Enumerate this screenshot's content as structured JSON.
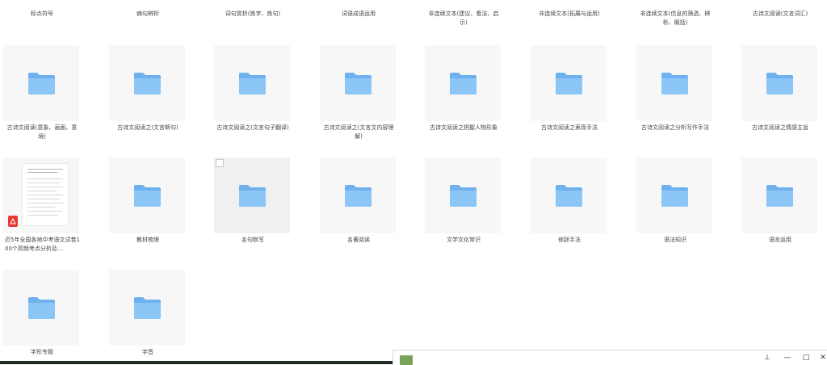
{
  "top_row_labels": [
    "标点符号",
    "病句辨析",
    "词句赏析(炼字、炼句)",
    "词语成语运用",
    "非连续文本(建议、看法、启示)",
    "非连续文本(拓展与运用)",
    "非连续文本(信息的筛选、辨析、概括)",
    "古诗文阅读(文言词汇)"
  ],
  "row2": [
    "古诗文阅读(意象、画面、意境)",
    "古诗文阅读之(文言断句)",
    "古诗文阅读之(文言句子翻译)",
    "古诗文阅读之(文言文内容理解)",
    "古诗文阅读之把握人物形象",
    "古诗文阅读之表现手法",
    "古诗文阅读之分析写作手法",
    "古诗文阅读之情感主旨"
  ],
  "row3": [
    "近5年全国各地中考语文试卷100个高频考点分析及...",
    "教材梳理",
    "名句默写",
    "名著阅读",
    "文学文化常识",
    "修辞手法",
    "语法知识",
    "语言运用"
  ],
  "row4": [
    "字形专题",
    "字音"
  ],
  "icons": {
    "folder": "folder-icon",
    "pdf": "pdf-icon"
  },
  "colors": {
    "folder_back": "#6fb1ef",
    "folder_front": "#8cc6f7",
    "pdf_red": "#e53935"
  },
  "taskbar": {
    "pin": "⊥",
    "minimize": "—",
    "maximize": "□",
    "close": "✕"
  }
}
